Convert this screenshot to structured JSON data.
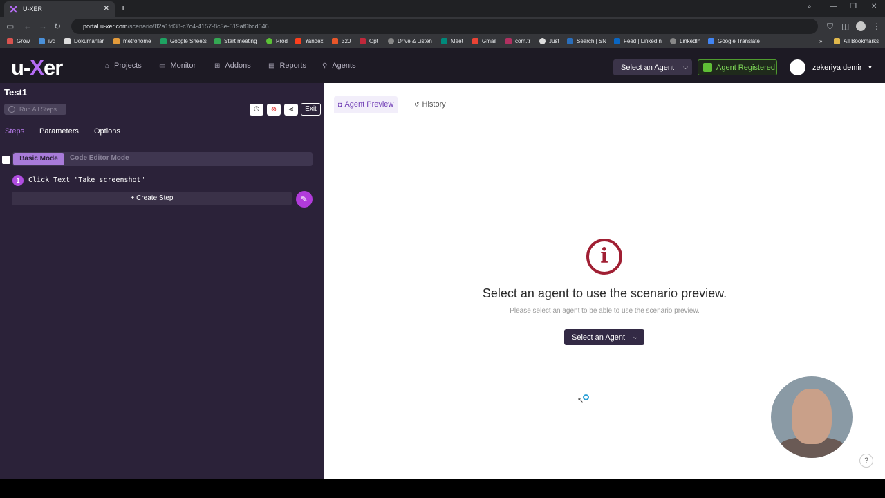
{
  "browser": {
    "tab_title": "U-XER",
    "tab_close": "✕",
    "new_tab": "+",
    "url_host": "portal.u-xer.com",
    "url_path": "/scenario/82a1fd38-c7c4-4157-8c3e-519af6bcd546",
    "bookmarks": [
      "Grow",
      "ivd",
      "Dokümanlar",
      "metronome",
      "Google Sheets",
      "Start meeting",
      "Prod",
      "Yandex",
      "320",
      "Opt",
      "Drive & Listen",
      "Meet",
      "Gmail",
      "com.tr",
      "Just",
      "Search | SN",
      "Feed | LinkedIn",
      "LinkedIn",
      "Google Translate"
    ],
    "all_bookmarks": "All Bookmarks",
    "more": "»"
  },
  "header": {
    "logo_a": "u-",
    "logo_x": "X",
    "logo_b": "er",
    "nav": [
      "Projects",
      "Monitor",
      "Addons",
      "Reports",
      "Agents"
    ],
    "select_agent": "Select an Agent",
    "agent_registered": "Agent Registered",
    "user_name": "zekeriya demir"
  },
  "left": {
    "title": "Test1",
    "run_all": "Run All Steps",
    "exit": "Exit",
    "tabs": [
      "Steps",
      "Parameters",
      "Options"
    ],
    "mode_basic": "Basic Mode",
    "mode_code": "Code Editor Mode",
    "step_number": "1",
    "step_text": "Click Text \"Take screenshot\"",
    "create_step": "Create Step"
  },
  "right": {
    "tab_preview": "Agent Preview",
    "tab_history": "History",
    "info_glyph": "i",
    "heading": "Select an agent to use the scenario preview.",
    "subtext": "Please select an agent to be able to use the scenario preview.",
    "button": "Select an Agent",
    "help": "?"
  },
  "colors": {
    "accent": "#b04de0",
    "left_panel": "#2b2239",
    "info_red": "#a01f33",
    "registered_green": "#7ed957"
  }
}
